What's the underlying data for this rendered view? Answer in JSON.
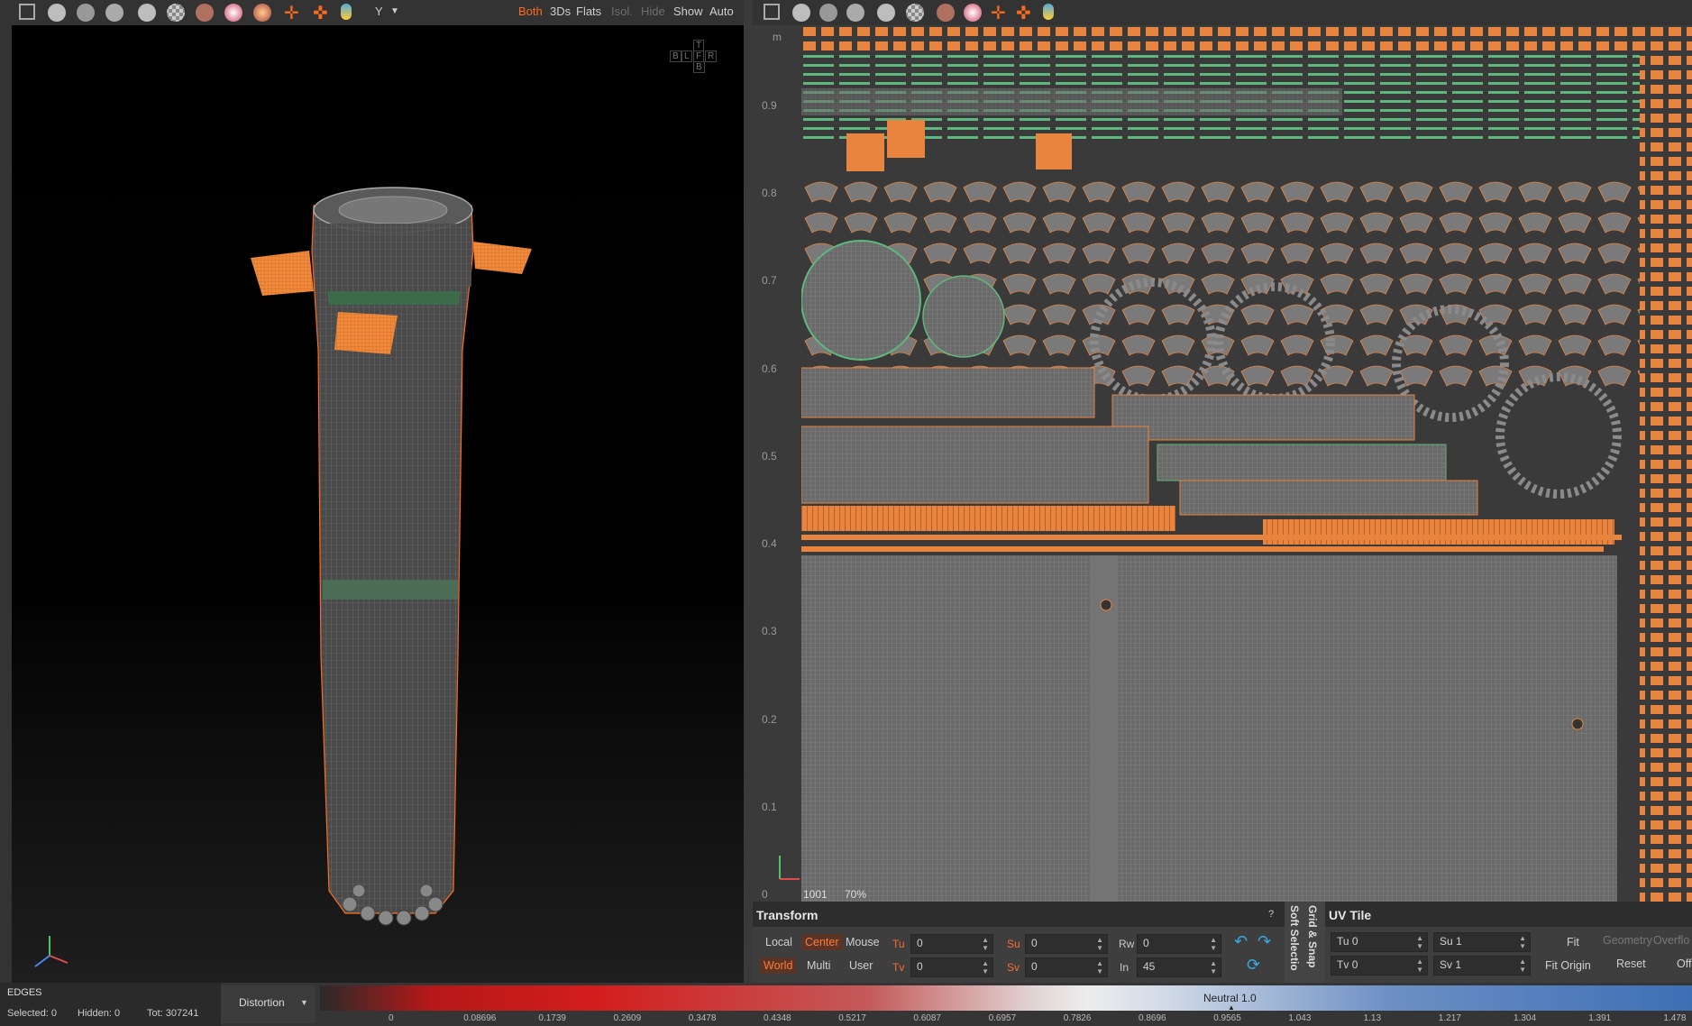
{
  "viewport3d": {
    "toolbar": {
      "icons": [
        "frame-icon",
        "sphere-icon",
        "wire-sphere-icon",
        "grid-sphere-icon",
        "solid-sphere-icon",
        "checker-icon",
        "texture-sphere-icon",
        "material-sphere-icon",
        "lit-sphere-icon",
        "move-icon",
        "gizmo-icon",
        "light-icon"
      ],
      "axis": "Y",
      "buttons": [
        {
          "label": "Both",
          "state": "active"
        },
        {
          "label": "3Ds",
          "state": "normal"
        },
        {
          "label": "Flats",
          "state": "normal"
        },
        {
          "label": "Isol.",
          "state": "disabled"
        },
        {
          "label": "Hide",
          "state": "disabled"
        },
        {
          "label": "Show",
          "state": "normal"
        },
        {
          "label": "Auto",
          "state": "normal"
        }
      ]
    },
    "nav_cube": {
      "top": "T",
      "left": "L",
      "bottom": "B",
      "right": "R",
      "front": "F",
      "back": "B"
    }
  },
  "uv_view": {
    "ruler_unit": "m",
    "ruler_ticks": [
      "0.9",
      "0.8",
      "0.7",
      "0.6",
      "0.5",
      "0.4",
      "0.3",
      "0.2",
      "0.1",
      "0"
    ],
    "tile": "1001",
    "zoom": "70%"
  },
  "transform": {
    "title": "Transform",
    "help": "?",
    "row1": {
      "local": "Local",
      "center": "Center",
      "mouse": "Mouse",
      "tu_label": "Tu",
      "tu": "0",
      "su_label": "Su",
      "su": "0",
      "rw_label": "Rw",
      "rw": "0"
    },
    "row2": {
      "world": "World",
      "multi": "Multi",
      "user": "User",
      "tv_label": "Tv",
      "tv": "0",
      "sv_label": "Sv",
      "sv": "0",
      "in_label": "In",
      "in": "45"
    }
  },
  "side_tabs": {
    "soft": "Soft Selectio",
    "grid": "Grid & Snap"
  },
  "uv_tile": {
    "title": "UV Tile",
    "tu_label": "Tu",
    "tu": "0",
    "su_label": "Su",
    "su": "1",
    "tv_label": "Tv",
    "tv": "0",
    "sv_label": "Sv",
    "sv": "1",
    "fit": "Fit",
    "fit_origin": "Fit Origin",
    "geometry": "Geometry",
    "reset": "Reset",
    "overflow": "Overflo",
    "off": "Off"
  },
  "status": {
    "mode": "EDGES",
    "selected": "Selected: 0",
    "hidden": "Hidden: 0",
    "total": "Tot: 307241",
    "display": "Distortion",
    "neutral": "Neutral 1.0",
    "ticks": [
      "0",
      "0.08696",
      "0.1739",
      "0.2609",
      "0.3478",
      "0.4348",
      "0.5217",
      "0.6087",
      "0.6957",
      "0.7826",
      "0.8696",
      "0.9565",
      "1.043",
      "1.13",
      "1.217",
      "1.304",
      "1.391",
      "1.478"
    ]
  },
  "colors": {
    "accent": "#ff6a1c",
    "island_orange": "#f08a3a",
    "island_green": "#6fcf8c",
    "mesh_grey": "#9a9a9a"
  }
}
